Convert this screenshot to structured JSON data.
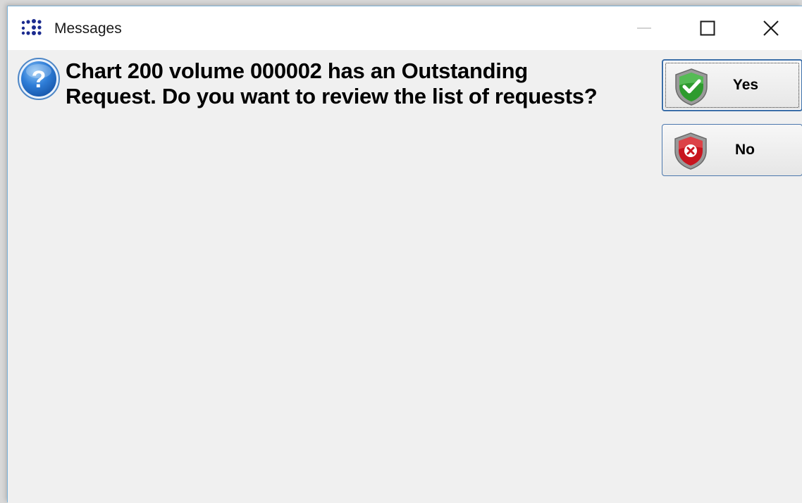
{
  "window": {
    "title": "Messages",
    "icon": "app-dots-icon"
  },
  "titlebar_controls": {
    "minimize_icon": "minimize-icon",
    "maximize_icon": "maximize-icon",
    "close_icon": "close-icon"
  },
  "dialog": {
    "icon": "question-icon",
    "message": "Chart 200 volume  000002 has an Outstanding\nRequest.  Do you want to review the list of requests?",
    "buttons": {
      "yes": {
        "label": "Yes",
        "icon": "shield-check-icon"
      },
      "no": {
        "label": "No",
        "icon": "shield-x-icon"
      }
    }
  },
  "colors": {
    "titlebar_bg": "#ffffff",
    "dialog_bg": "#f0f0f0",
    "window_border": "#7ab0d6",
    "default_button_border": "#3b6ea8",
    "yes_shield": "#2e9b2e",
    "no_shield": "#c8141e",
    "question_icon": "#2f7ed8"
  }
}
